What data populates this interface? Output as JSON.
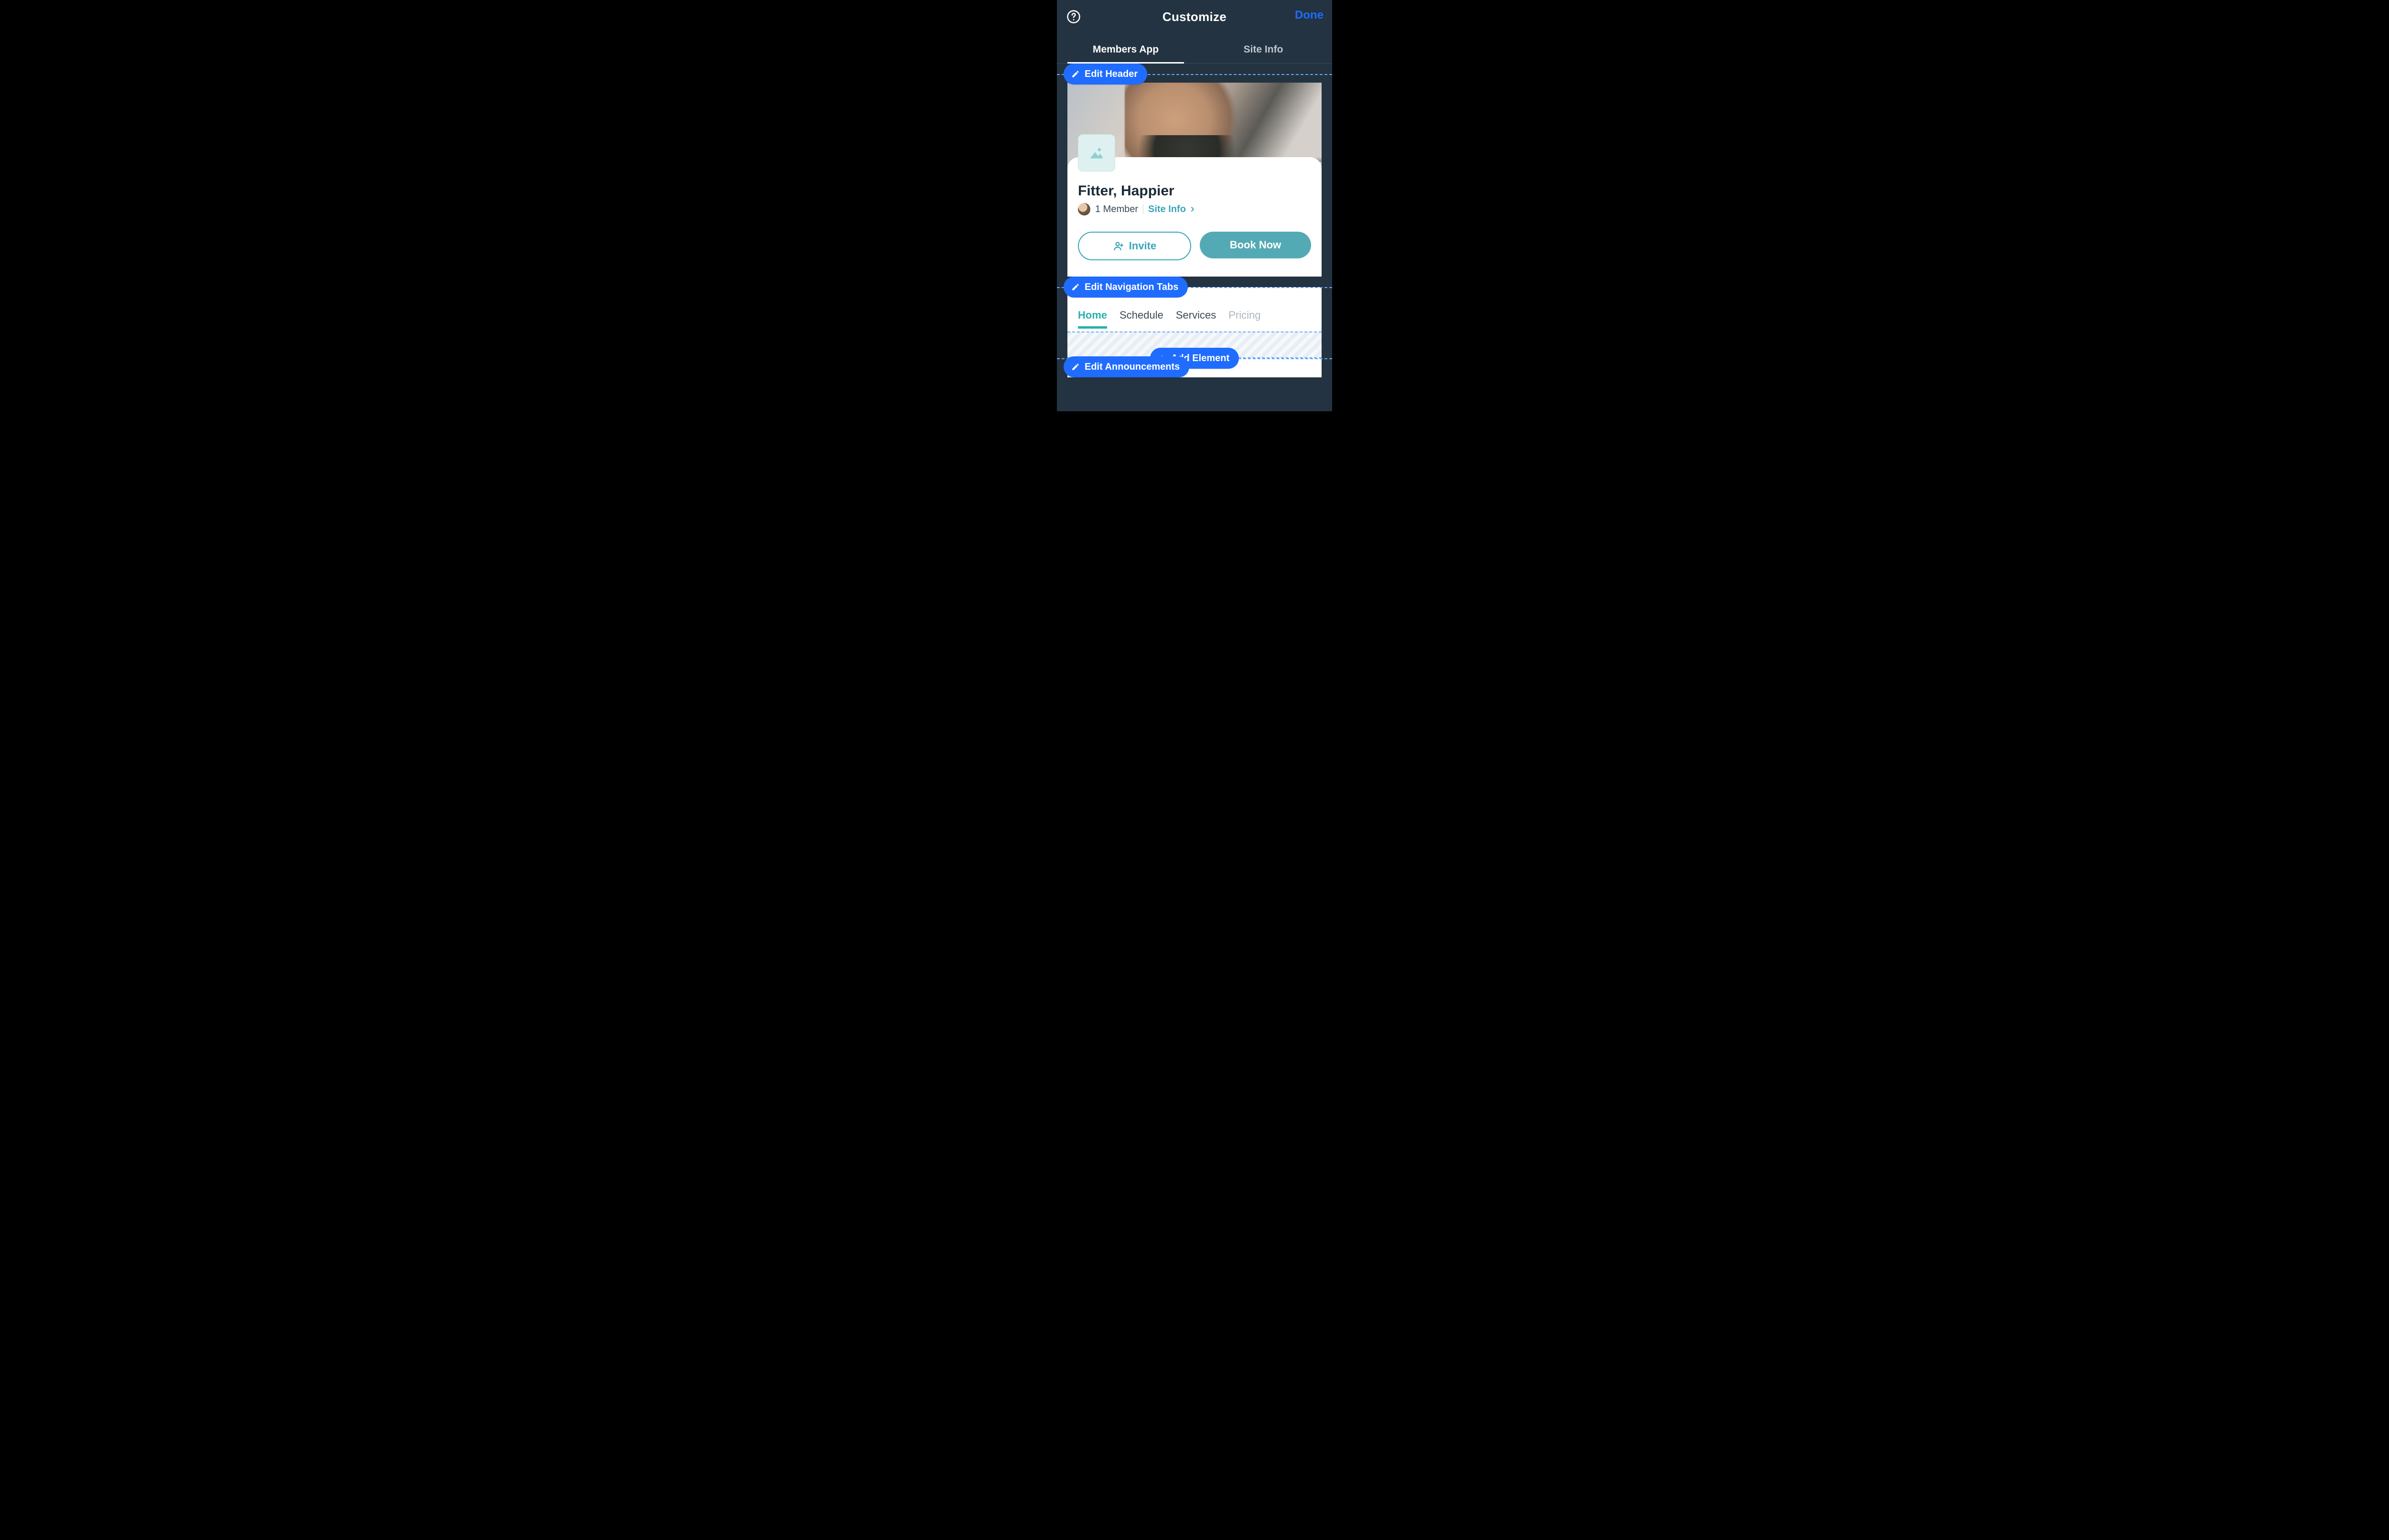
{
  "colors": {
    "accent_blue": "#1f6cff",
    "teal": "#29b2ad",
    "teal_solid": "#53aab4",
    "dark_bg": "#233341"
  },
  "topbar": {
    "title": "Customize",
    "done": "Done"
  },
  "tabs": [
    "Members App",
    "Site Info"
  ],
  "active_tab_index": 0,
  "edit_header_label": "Edit Header",
  "site": {
    "name": "Fitter, Happier",
    "members_count_label": "1 Member",
    "site_info_link": "Site Info"
  },
  "cta": {
    "invite": "Invite",
    "book": "Book Now"
  },
  "edit_nav_label": "Edit Navigation Tabs",
  "nav_tabs": [
    "Home",
    "Schedule",
    "Services",
    "Pricing"
  ],
  "nav_active_index": 0,
  "add_element_label": "Add Element",
  "edit_announcements_label": "Edit Announcements",
  "icons": {
    "help": "help-circle-icon",
    "pencil": "pencil-icon",
    "plus": "plus-icon",
    "image": "image-placeholder-icon",
    "invite": "person-add-icon",
    "chevron": "chevron-right-icon"
  }
}
